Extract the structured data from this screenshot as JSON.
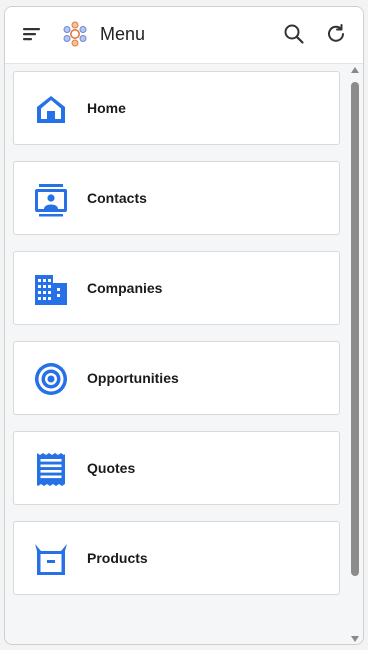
{
  "header": {
    "title": "Menu",
    "icons": {
      "menu": "hamburger-icon",
      "app": "salesforce-app-icon",
      "search": "search-icon",
      "refresh": "refresh-icon"
    }
  },
  "colors": {
    "accent": "#2670e8",
    "border": "#d9d9d9",
    "background": "#f5f6f8"
  },
  "menu": {
    "items": [
      {
        "label": "Home",
        "icon": "home-icon"
      },
      {
        "label": "Contacts",
        "icon": "contact-icon"
      },
      {
        "label": "Companies",
        "icon": "building-icon"
      },
      {
        "label": "Opportunities",
        "icon": "target-icon"
      },
      {
        "label": "Quotes",
        "icon": "receipt-icon"
      },
      {
        "label": "Products",
        "icon": "box-icon"
      }
    ]
  }
}
